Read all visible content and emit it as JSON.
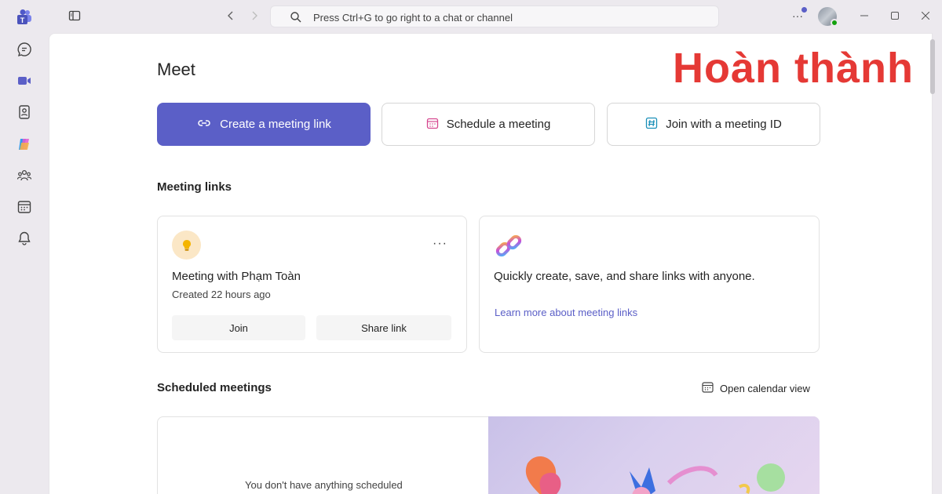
{
  "titlebar": {
    "search_placeholder": "Press Ctrl+G to go right to a chat or channel",
    "more_label": "···"
  },
  "rail": {
    "items": [
      {
        "icon": "teams-logo-icon"
      },
      {
        "icon": "chat-icon"
      },
      {
        "icon": "meet-video-icon"
      },
      {
        "icon": "contacts-icon"
      },
      {
        "icon": "copilot-icon"
      },
      {
        "icon": "communities-icon"
      },
      {
        "icon": "calendar-icon"
      },
      {
        "icon": "bell-icon"
      }
    ]
  },
  "page": {
    "title": "Meet",
    "overlay": "Hoàn thành"
  },
  "actions": {
    "create_link": "Create a meeting link",
    "schedule": "Schedule a meeting",
    "join_id": "Join with a meeting ID"
  },
  "meeting_links": {
    "title": "Meeting links",
    "card": {
      "name": "Meeting with Phạm Toàn",
      "created": "Created 22 hours ago",
      "join_label": "Join",
      "share_label": "Share link",
      "more_label": "···"
    },
    "promo": {
      "text": "Quickly create, save, and share links with anyone.",
      "link": "Learn more about meeting links"
    }
  },
  "scheduled": {
    "title": "Scheduled meetings",
    "calendar_view": "Open calendar view",
    "empty_text": "You don't have anything scheduled"
  },
  "colors": {
    "accent": "#5b5fc7",
    "overlay_red": "#e53935",
    "presence_green": "#13a10e"
  }
}
